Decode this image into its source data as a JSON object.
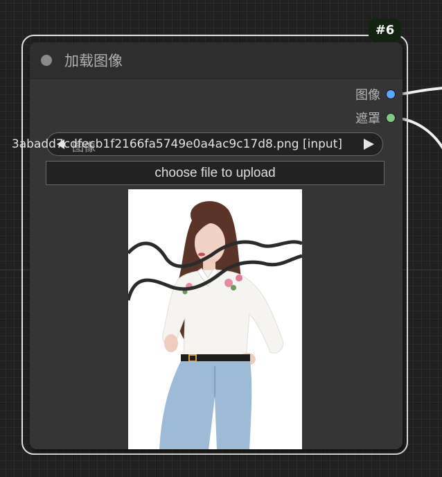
{
  "canvas": {
    "background": "#202020",
    "link_color": "#f2f2f2"
  },
  "node": {
    "id_badge": "#6",
    "title": "加载图像",
    "status_dot": "gray-collapse-dot",
    "outputs": [
      {
        "label": "图像",
        "type": "IMAGE",
        "color": "#5aa8ff"
      },
      {
        "label": "遮罩",
        "type": "MASK",
        "color": "#81c784"
      }
    ],
    "widgets": {
      "image_combo": {
        "label": "图像",
        "value": "3abadd7cdfecb1f2166fa5749e0a4ac9c17d8.png [input]",
        "prev_icon": "left-triangle-icon",
        "next_icon": "right-triangle-icon"
      },
      "upload_button": {
        "label": "choose file to upload"
      }
    },
    "preview": {
      "subject": "woman in white embroidered blouse and light blue jeans",
      "background": "#ffffff"
    }
  }
}
